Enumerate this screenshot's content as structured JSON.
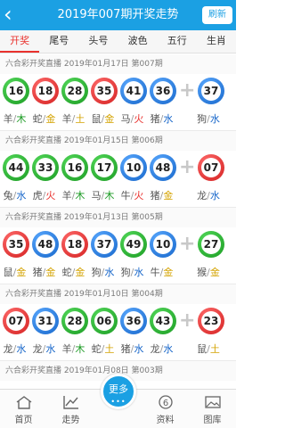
{
  "header": {
    "back_icon": "back-arrow-icon",
    "title": "2019年007期开奖走势",
    "refresh_label": "刷新"
  },
  "tabs": [
    "开奖",
    "尾号",
    "头号",
    "波色",
    "五行",
    "生肖"
  ],
  "colors": {
    "red": "#e9322e",
    "green": "#1a9a22",
    "blue": "#1565c9",
    "gold": "#d4a300",
    "accent": "#1ba0e3"
  },
  "draws": [
    {
      "title": "六合彩开奖直播 2019年01月17日 第007期",
      "balls": [
        {
          "num": "16",
          "color": "g",
          "zodiac": "羊",
          "element": "木",
          "ec": "green"
        },
        {
          "num": "18",
          "color": "r",
          "zodiac": "蛇",
          "element": "金",
          "ec": "gold"
        },
        {
          "num": "28",
          "color": "g",
          "zodiac": "羊",
          "element": "土",
          "ec": "gold"
        },
        {
          "num": "35",
          "color": "r",
          "zodiac": "鼠",
          "element": "金",
          "ec": "gold"
        },
        {
          "num": "41",
          "color": "b",
          "zodiac": "马",
          "element": "火",
          "ec": "red"
        },
        {
          "num": "36",
          "color": "b",
          "zodiac": "猪",
          "element": "水",
          "ec": "blue"
        },
        {
          "num": "37",
          "color": "b",
          "zodiac": "狗",
          "element": "水",
          "ec": "blue"
        }
      ]
    },
    {
      "title": "六合彩开奖直播 2019年01月15日 第006期",
      "balls": [
        {
          "num": "44",
          "color": "g",
          "zodiac": "兔",
          "element": "水",
          "ec": "blue"
        },
        {
          "num": "33",
          "color": "g",
          "zodiac": "虎",
          "element": "火",
          "ec": "red"
        },
        {
          "num": "16",
          "color": "g",
          "zodiac": "羊",
          "element": "木",
          "ec": "green"
        },
        {
          "num": "17",
          "color": "g",
          "zodiac": "马",
          "element": "木",
          "ec": "green"
        },
        {
          "num": "10",
          "color": "b",
          "zodiac": "牛",
          "element": "火",
          "ec": "red"
        },
        {
          "num": "48",
          "color": "b",
          "zodiac": "猪",
          "element": "金",
          "ec": "gold"
        },
        {
          "num": "07",
          "color": "r",
          "zodiac": "龙",
          "element": "水",
          "ec": "blue"
        }
      ]
    },
    {
      "title": "六合彩开奖直播 2019年01月13日 第005期",
      "balls": [
        {
          "num": "35",
          "color": "r",
          "zodiac": "鼠",
          "element": "金",
          "ec": "gold"
        },
        {
          "num": "48",
          "color": "b",
          "zodiac": "猪",
          "element": "金",
          "ec": "gold"
        },
        {
          "num": "18",
          "color": "r",
          "zodiac": "蛇",
          "element": "金",
          "ec": "gold"
        },
        {
          "num": "37",
          "color": "b",
          "zodiac": "狗",
          "element": "水",
          "ec": "blue"
        },
        {
          "num": "49",
          "color": "g",
          "zodiac": "狗",
          "element": "水",
          "ec": "blue"
        },
        {
          "num": "10",
          "color": "b",
          "zodiac": "牛",
          "element": "金",
          "ec": "gold"
        },
        {
          "num": "27",
          "color": "g",
          "zodiac": "猴",
          "element": "金",
          "ec": "gold"
        }
      ]
    },
    {
      "title": "六合彩开奖直播 2019年01月10日 第004期",
      "balls": [
        {
          "num": "07",
          "color": "r",
          "zodiac": "龙",
          "element": "水",
          "ec": "blue"
        },
        {
          "num": "31",
          "color": "b",
          "zodiac": "龙",
          "element": "水",
          "ec": "blue"
        },
        {
          "num": "28",
          "color": "g",
          "zodiac": "羊",
          "element": "木",
          "ec": "green"
        },
        {
          "num": "06",
          "color": "g",
          "zodiac": "蛇",
          "element": "土",
          "ec": "gold"
        },
        {
          "num": "36",
          "color": "b",
          "zodiac": "猪",
          "element": "水",
          "ec": "blue"
        },
        {
          "num": "43",
          "color": "g",
          "zodiac": "龙",
          "element": "水",
          "ec": "blue"
        },
        {
          "num": "23",
          "color": "r",
          "zodiac": "鼠",
          "element": "土",
          "ec": "gold"
        }
      ]
    },
    {
      "title": "六合彩开奖直播 2019年01月08日 第003期",
      "balls": []
    }
  ],
  "bottom_nav": [
    {
      "label": "首页",
      "icon": "home-icon"
    },
    {
      "label": "走势",
      "icon": "trend-icon"
    },
    {
      "label": "更多",
      "icon": "more-dots-icon"
    },
    {
      "label": "资料",
      "icon": "info-6-icon"
    },
    {
      "label": "图库",
      "icon": "gallery-icon"
    }
  ]
}
